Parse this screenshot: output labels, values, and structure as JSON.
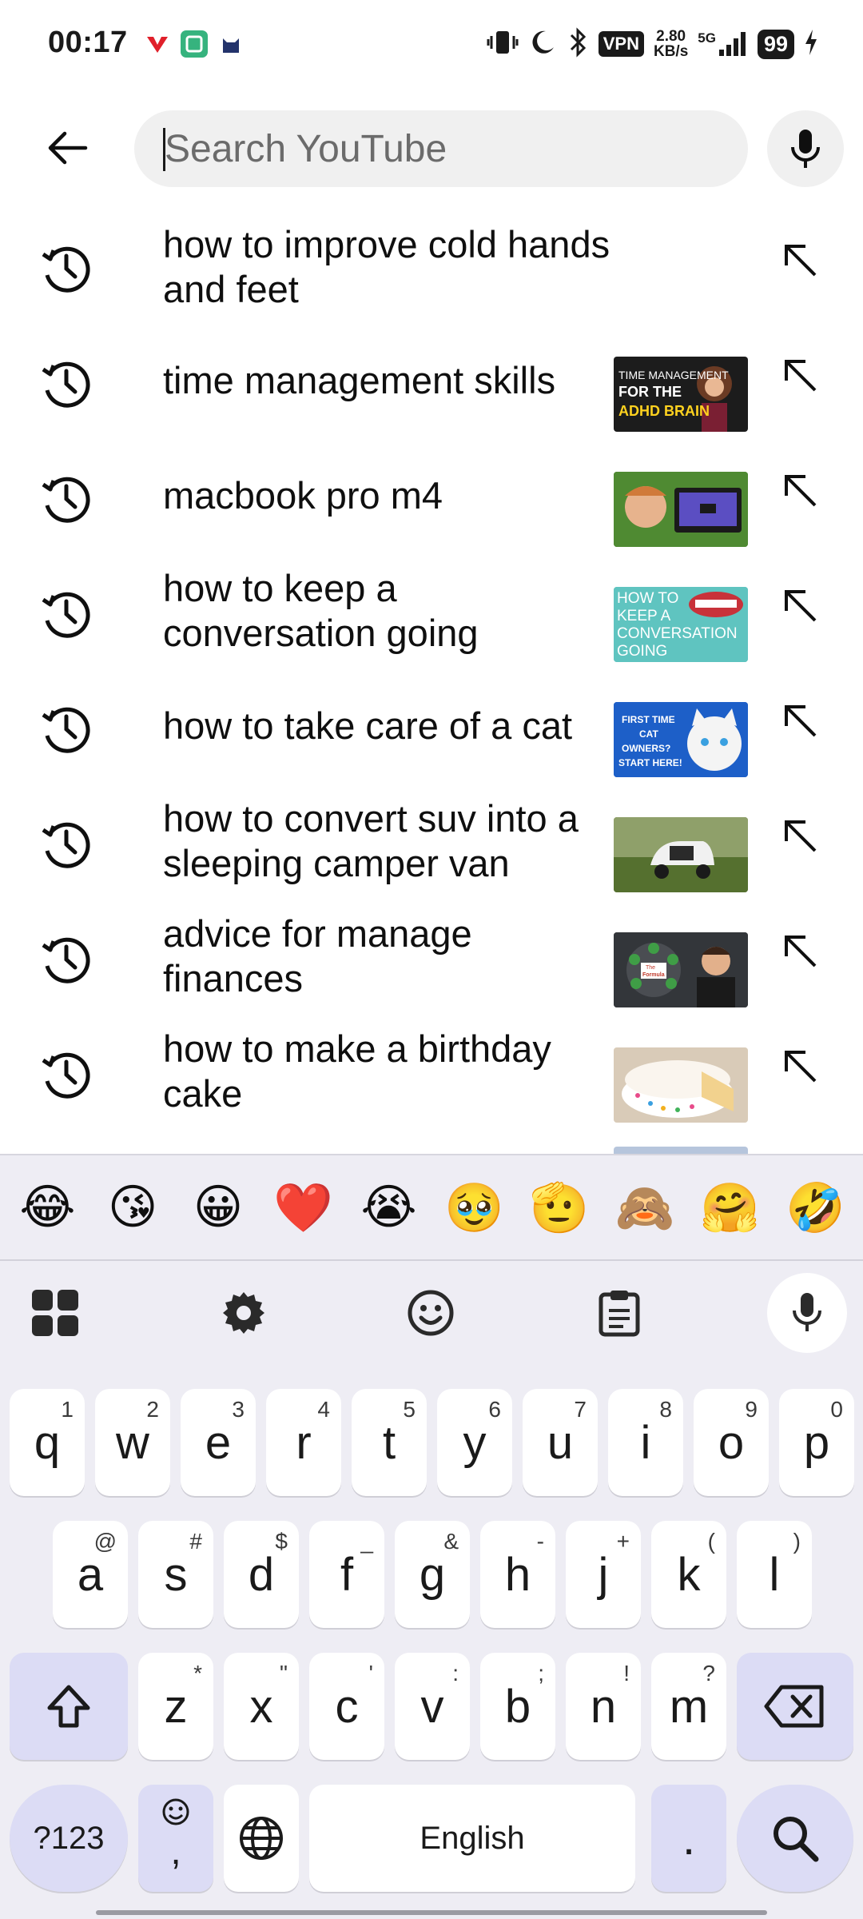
{
  "status_bar": {
    "time": "00:17",
    "vpn_label": "VPN",
    "speed_value": "2.80",
    "speed_unit": "KB/s",
    "network": "5G",
    "battery": "99"
  },
  "search": {
    "placeholder": "Search YouTube",
    "value": ""
  },
  "suggestions": [
    {
      "text": "how to improve cold hands and feet",
      "has_thumbnail": false
    },
    {
      "text": "time management skills",
      "has_thumbnail": true,
      "thumbnail_text": [
        "TIME MANAGEMENT",
        "FOR THE",
        "ADHD BRAIN"
      ]
    },
    {
      "text": "macbook pro m4",
      "has_thumbnail": true
    },
    {
      "text": "how to keep a conversation going",
      "has_thumbnail": true,
      "thumbnail_text": [
        "HOW TO",
        "KEEP A",
        "CONVERSATION",
        "GOING"
      ]
    },
    {
      "text": "how to take care of a cat",
      "has_thumbnail": true,
      "thumbnail_text": [
        "FIRST TIME",
        "CAT",
        "OWNERS?",
        "START HERE!"
      ]
    },
    {
      "text": "how to convert suv into a sleeping camper van",
      "has_thumbnail": true
    },
    {
      "text": "advice for manage finances",
      "has_thumbnail": true,
      "thumbnail_text": [
        "The",
        "Formula"
      ]
    },
    {
      "text": "how to make a birthday cake",
      "has_thumbnail": true
    }
  ],
  "keyboard": {
    "emojis": [
      "😂",
      "😘",
      "😀",
      "❤️",
      "😭",
      "🥹",
      "🫡",
      "🙈",
      "🤗",
      "🤣"
    ],
    "row1": [
      {
        "key": "q",
        "hint": "1"
      },
      {
        "key": "w",
        "hint": "2"
      },
      {
        "key": "e",
        "hint": "3"
      },
      {
        "key": "r",
        "hint": "4"
      },
      {
        "key": "t",
        "hint": "5"
      },
      {
        "key": "y",
        "hint": "6"
      },
      {
        "key": "u",
        "hint": "7"
      },
      {
        "key": "i",
        "hint": "8"
      },
      {
        "key": "o",
        "hint": "9"
      },
      {
        "key": "p",
        "hint": "0"
      }
    ],
    "row2": [
      {
        "key": "a",
        "hint": "@"
      },
      {
        "key": "s",
        "hint": "#"
      },
      {
        "key": "d",
        "hint": "$"
      },
      {
        "key": "f",
        "hint": "_"
      },
      {
        "key": "g",
        "hint": "&"
      },
      {
        "key": "h",
        "hint": "-"
      },
      {
        "key": "j",
        "hint": "+"
      },
      {
        "key": "k",
        "hint": "("
      },
      {
        "key": "l",
        "hint": ")"
      }
    ],
    "row3": [
      {
        "key": "z",
        "hint": "*"
      },
      {
        "key": "x",
        "hint": "\""
      },
      {
        "key": "c",
        "hint": "'"
      },
      {
        "key": "v",
        "hint": ":"
      },
      {
        "key": "b",
        "hint": ";"
      },
      {
        "key": "n",
        "hint": "!"
      },
      {
        "key": "m",
        "hint": "?"
      }
    ],
    "numbers_label": "?123",
    "comma_label": ",",
    "space_label": "English",
    "period_label": "."
  },
  "colors": {
    "keyboard_bg": "#eeedf4",
    "modifier_key": "#dcdcf5",
    "search_box": "#f0f0f0"
  }
}
